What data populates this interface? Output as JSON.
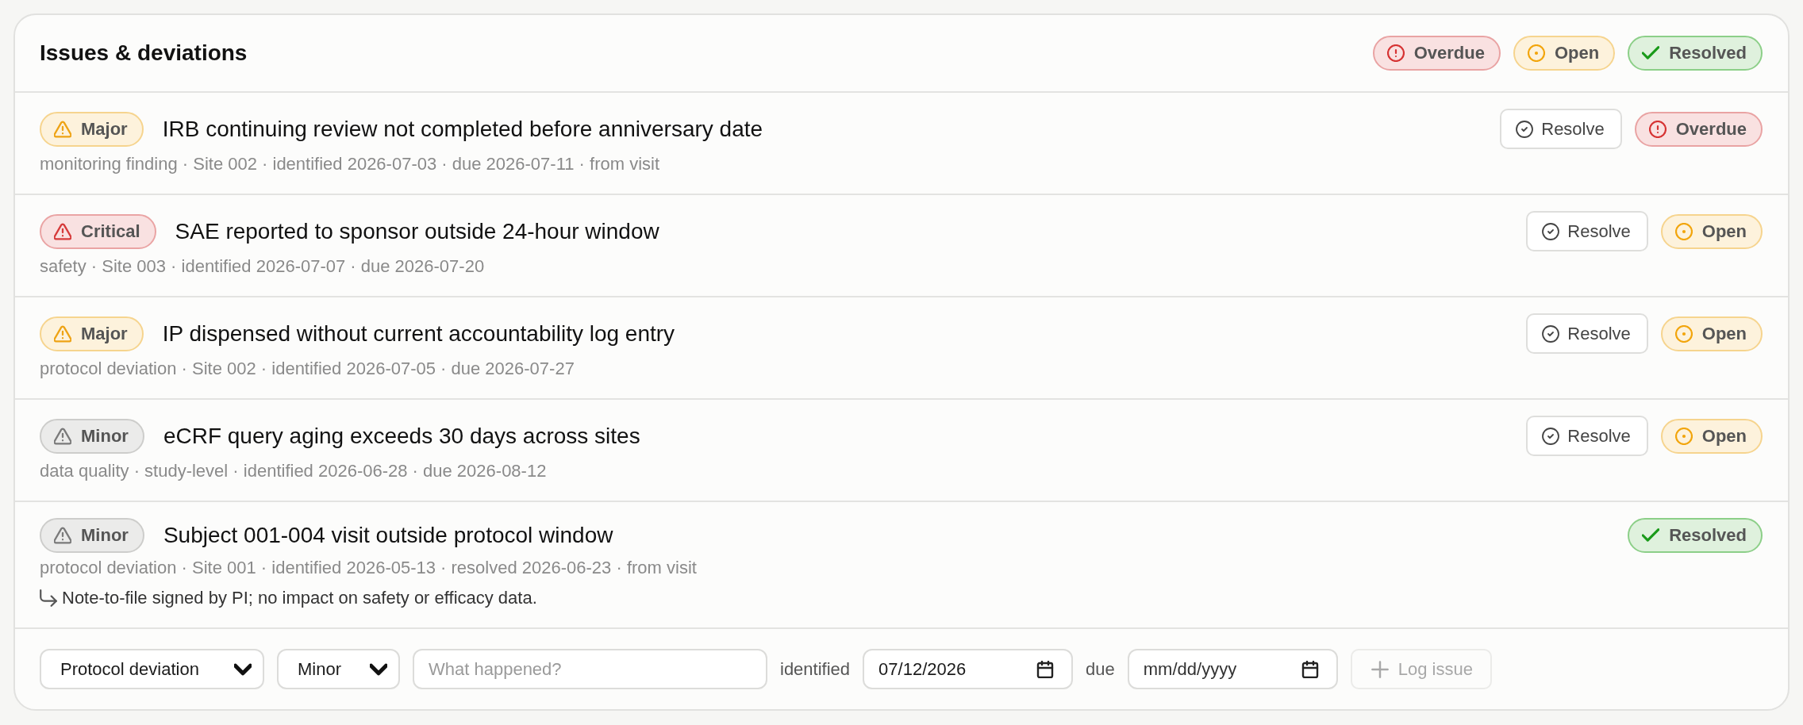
{
  "panel": {
    "title": "Issues & deviations"
  },
  "legend": [
    {
      "label": "Overdue",
      "kind": "overdue"
    },
    {
      "label": "Open",
      "kind": "open"
    },
    {
      "label": "Resolved",
      "kind": "resolved"
    }
  ],
  "issues": [
    {
      "severity": {
        "label": "Major",
        "kind": "major"
      },
      "title": "IRB continuing review not completed before anniversary date",
      "meta": "monitoring finding · Site 002 · identified 2026-07-03 · due 2026-07-11 · from visit",
      "action": "Resolve",
      "status": {
        "label": "Overdue",
        "kind": "overdue"
      }
    },
    {
      "severity": {
        "label": "Critical",
        "kind": "critical"
      },
      "title": "SAE reported to sponsor outside 24-hour window",
      "meta": "safety · Site 003 · identified 2026-07-07 · due 2026-07-20",
      "action": "Resolve",
      "status": {
        "label": "Open",
        "kind": "open"
      }
    },
    {
      "severity": {
        "label": "Major",
        "kind": "major"
      },
      "title": "IP dispensed without current accountability log entry",
      "meta": "protocol deviation · Site 002 · identified 2026-07-05 · due 2026-07-27",
      "action": "Resolve",
      "status": {
        "label": "Open",
        "kind": "open"
      }
    },
    {
      "severity": {
        "label": "Minor",
        "kind": "minor"
      },
      "title": "eCRF query aging exceeds 30 days across sites",
      "meta": "data quality · study-level · identified 2026-06-28 · due 2026-08-12",
      "action": "Resolve",
      "status": {
        "label": "Open",
        "kind": "open"
      }
    },
    {
      "severity": {
        "label": "Minor",
        "kind": "minor"
      },
      "title": "Subject 001-004 visit outside protocol window",
      "meta": "protocol deviation · Site 001 · identified 2026-05-13 · resolved 2026-06-23 · from visit",
      "status": {
        "label": "Resolved",
        "kind": "resolved"
      },
      "note": "Note-to-file signed by PI; no impact on safety or efficacy data."
    }
  ],
  "form": {
    "category": {
      "value": "Protocol deviation"
    },
    "severity": {
      "value": "Minor"
    },
    "description": {
      "placeholder": "What happened?"
    },
    "identified": {
      "label": "identified",
      "value": "07/12/2026"
    },
    "due": {
      "label": "due",
      "placeholder": "mm/dd/yyyy"
    },
    "submit": {
      "label": "Log issue",
      "disabled": true
    }
  }
}
